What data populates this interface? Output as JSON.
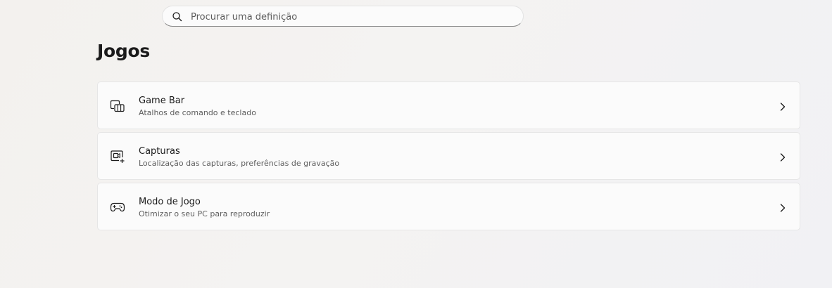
{
  "search": {
    "placeholder": "Procurar uma definição",
    "icon": "search-icon"
  },
  "page": {
    "title": "Jogos"
  },
  "cards": [
    {
      "title": "Game Bar",
      "description": "Atalhos de comando e teclado",
      "icon": "game-bar-icon"
    },
    {
      "title": "Capturas",
      "description": "Localização das capturas, preferências de gravação",
      "icon": "captures-icon"
    },
    {
      "title": "Modo de Jogo",
      "description": "Otimizar o seu PC para reproduzir",
      "icon": "game-mode-icon"
    }
  ],
  "colors": {
    "background": "#f3f2f1",
    "card": "#fbfbfb",
    "text_primary": "#1b1b1b",
    "text_secondary": "#5d5d5d"
  }
}
